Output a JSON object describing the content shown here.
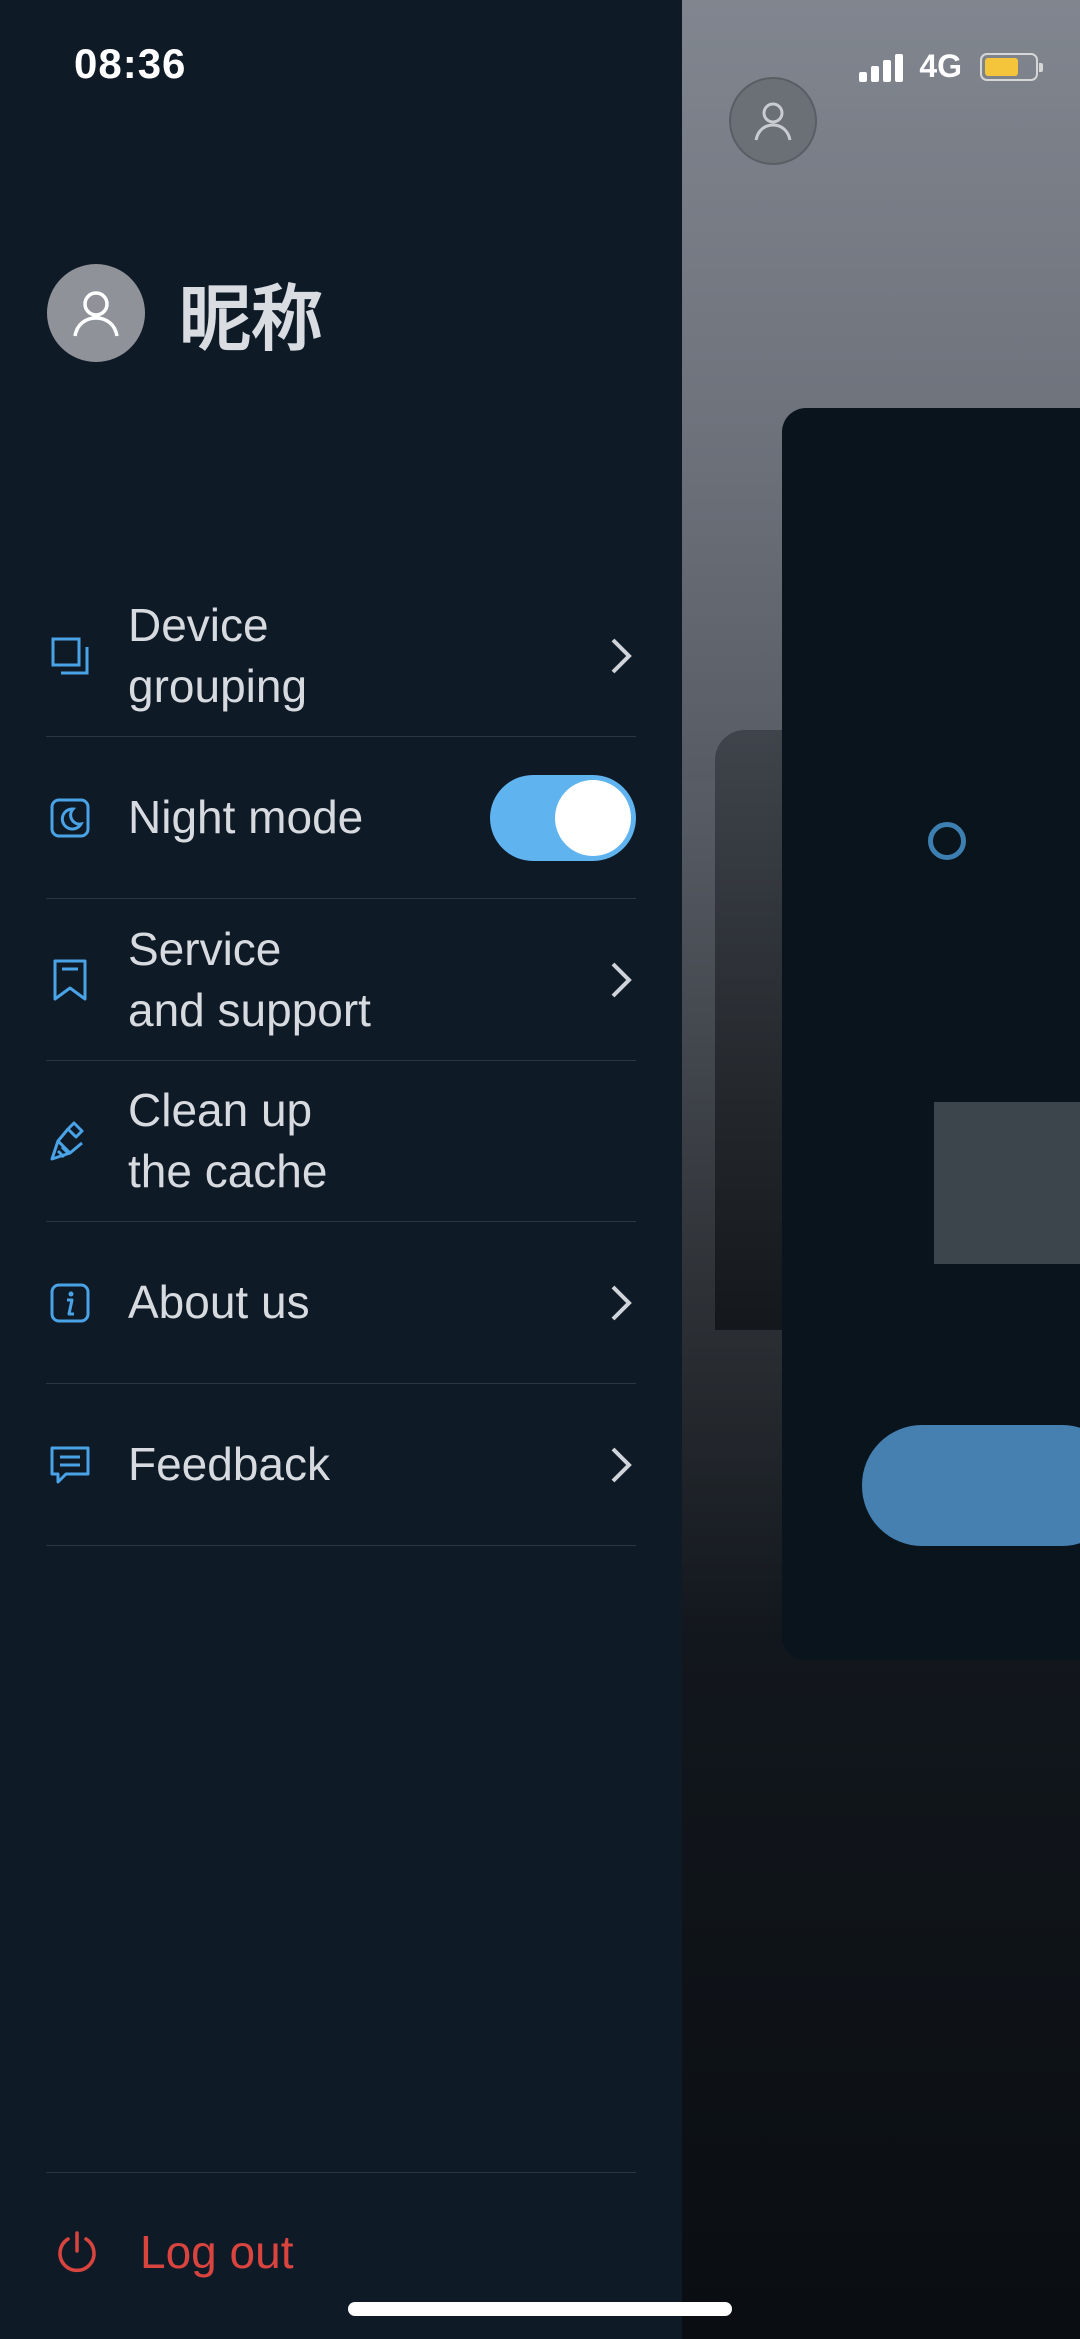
{
  "status_bar": {
    "time": "08:36",
    "network": "4G",
    "battery_color": "#f4c53b"
  },
  "profile": {
    "nickname": "昵称",
    "avatar_icon": "user-icon"
  },
  "menu": [
    {
      "label_line1": "Device",
      "label_line2": "grouping",
      "icon": "layers-icon",
      "trailing": "chevron"
    },
    {
      "label_line1": "Night mode",
      "icon": "moon-icon",
      "trailing": "toggle",
      "toggle_on": true
    },
    {
      "label_line1": "Service",
      "label_line2": "and support",
      "icon": "bookmark-icon",
      "trailing": "chevron"
    },
    {
      "label_line1": "Clean up",
      "label_line2": "the cache",
      "icon": "brush-icon",
      "trailing": "none"
    },
    {
      "label_line1": "About us",
      "icon": "info-icon",
      "trailing": "chevron"
    },
    {
      "label_line1": "Feedback",
      "icon": "message-icon",
      "trailing": "chevron"
    }
  ],
  "logout": {
    "label": "Log out",
    "icon": "power-icon",
    "color": "#d9453e"
  },
  "colors": {
    "drawer_bg": "#0f1a27",
    "accent": "#5fb3ef",
    "icon_blue": "#4aa3e6"
  }
}
